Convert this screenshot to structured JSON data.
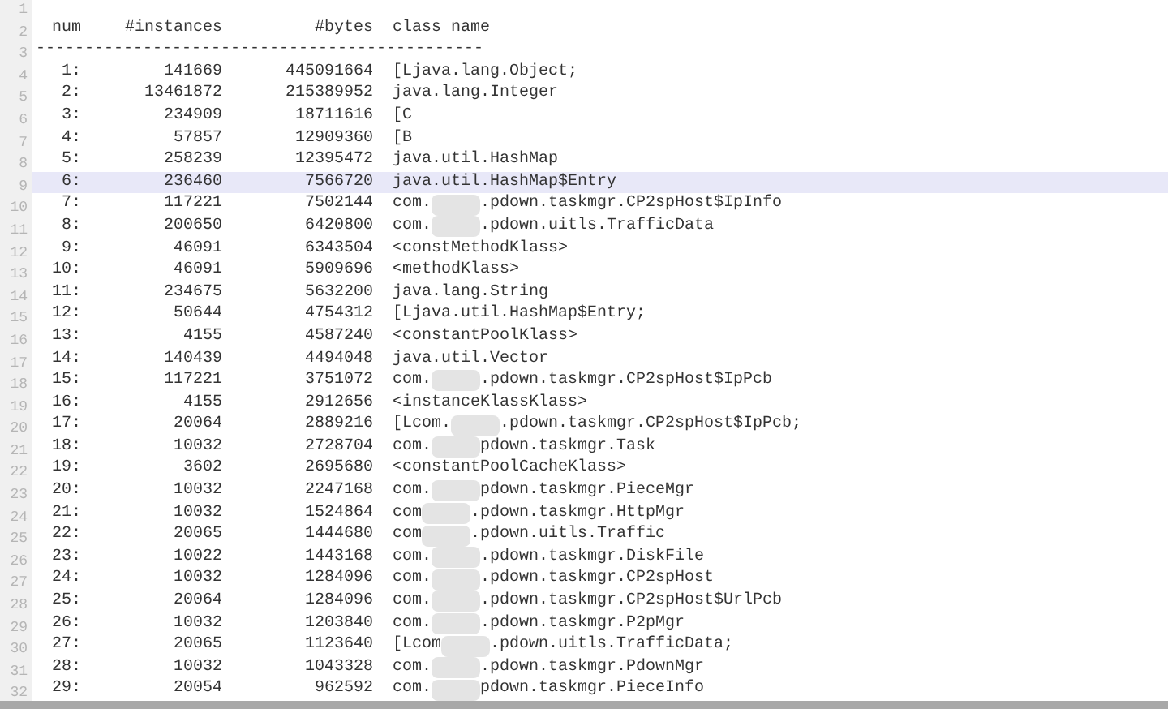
{
  "line_numbers": [
    "1",
    "2",
    "3",
    "4",
    "5",
    "6",
    "7",
    "8",
    "9",
    "10",
    "11",
    "12",
    "13",
    "14",
    "15",
    "16",
    "17",
    "18",
    "19",
    "20",
    "21",
    "22",
    "23",
    "24",
    "25",
    "26",
    "27",
    "28",
    "29",
    "30",
    "31",
    "32"
  ],
  "header": {
    "num": "num",
    "instances": "#instances",
    "bytes": "#bytes",
    "class_name": "class name"
  },
  "separator": "----------------------------------------------",
  "rows": [
    {
      "num": "1:",
      "instances": "141669",
      "bytes": "445091664",
      "class_name": "[Ljava.lang.Object;",
      "selected": false
    },
    {
      "num": "2:",
      "instances": "13461872",
      "bytes": "215389952",
      "class_name": "java.lang.Integer",
      "selected": false
    },
    {
      "num": "3:",
      "instances": "234909",
      "bytes": "18711616",
      "class_name": "[C",
      "selected": false
    },
    {
      "num": "4:",
      "instances": "57857",
      "bytes": "12909360",
      "class_name": "[B",
      "selected": false
    },
    {
      "num": "5:",
      "instances": "258239",
      "bytes": "12395472",
      "class_name": "java.util.HashMap",
      "selected": false
    },
    {
      "num": "6:",
      "instances": "236460",
      "bytes": "7566720",
      "class_name": "java.util.HashMap$Entry",
      "selected": true
    },
    {
      "num": "7:",
      "instances": "117221",
      "bytes": "7502144",
      "class_name": "com.",
      "after_redaction": ".pdown.taskmgr.CP2spHost$IpInfo",
      "selected": false
    },
    {
      "num": "8:",
      "instances": "200650",
      "bytes": "6420800",
      "class_name": "com.",
      "after_redaction": ".pdown.uitls.TrafficData",
      "selected": false
    },
    {
      "num": "9:",
      "instances": "46091",
      "bytes": "6343504",
      "class_name": "<constMethodKlass>",
      "selected": false
    },
    {
      "num": "10:",
      "instances": "46091",
      "bytes": "5909696",
      "class_name": "<methodKlass>",
      "selected": false
    },
    {
      "num": "11:",
      "instances": "234675",
      "bytes": "5632200",
      "class_name": "java.lang.String",
      "selected": false
    },
    {
      "num": "12:",
      "instances": "50644",
      "bytes": "4754312",
      "class_name": "[Ljava.util.HashMap$Entry;",
      "selected": false
    },
    {
      "num": "13:",
      "instances": "4155",
      "bytes": "4587240",
      "class_name": "<constantPoolKlass>",
      "selected": false
    },
    {
      "num": "14:",
      "instances": "140439",
      "bytes": "4494048",
      "class_name": "java.util.Vector",
      "selected": false
    },
    {
      "num": "15:",
      "instances": "117221",
      "bytes": "3751072",
      "class_name": "com.",
      "after_redaction": ".pdown.taskmgr.CP2spHost$IpPcb",
      "selected": false
    },
    {
      "num": "16:",
      "instances": "4155",
      "bytes": "2912656",
      "class_name": "<instanceKlassKlass>",
      "selected": false
    },
    {
      "num": "17:",
      "instances": "20064",
      "bytes": "2889216",
      "class_name": "[Lcom.",
      "after_redaction": ".pdown.taskmgr.CP2spHost$IpPcb;",
      "selected": false
    },
    {
      "num": "18:",
      "instances": "10032",
      "bytes": "2728704",
      "class_name": "com.",
      "after_redaction": "pdown.taskmgr.Task",
      "selected": false
    },
    {
      "num": "19:",
      "instances": "3602",
      "bytes": "2695680",
      "class_name": "<constantPoolCacheKlass>",
      "selected": false
    },
    {
      "num": "20:",
      "instances": "10032",
      "bytes": "2247168",
      "class_name": "com.",
      "after_redaction": "pdown.taskmgr.PieceMgr",
      "selected": false
    },
    {
      "num": "21:",
      "instances": "10032",
      "bytes": "1524864",
      "class_name": "com",
      "after_redaction": ".pdown.taskmgr.HttpMgr",
      "selected": false
    },
    {
      "num": "22:",
      "instances": "20065",
      "bytes": "1444680",
      "class_name": "com",
      "after_redaction": ".pdown.uitls.Traffic",
      "selected": false
    },
    {
      "num": "23:",
      "instances": "10022",
      "bytes": "1443168",
      "class_name": "com.",
      "after_redaction": ".pdown.taskmgr.DiskFile",
      "selected": false
    },
    {
      "num": "24:",
      "instances": "10032",
      "bytes": "1284096",
      "class_name": "com.",
      "after_redaction": ".pdown.taskmgr.CP2spHost",
      "selected": false
    },
    {
      "num": "25:",
      "instances": "20064",
      "bytes": "1284096",
      "class_name": "com.",
      "after_redaction": ".pdown.taskmgr.CP2spHost$UrlPcb",
      "selected": false
    },
    {
      "num": "26:",
      "instances": "10032",
      "bytes": "1203840",
      "class_name": "com.",
      "after_redaction": ".pdown.taskmgr.P2pMgr",
      "selected": false
    },
    {
      "num": "27:",
      "instances": "20065",
      "bytes": "1123640",
      "class_name": "[Lcom",
      "after_redaction": ".pdown.uitls.TrafficData;",
      "selected": false
    },
    {
      "num": "28:",
      "instances": "10032",
      "bytes": "1043328",
      "class_name": "com.",
      "after_redaction": ".pdown.taskmgr.PdownMgr",
      "selected": false
    },
    {
      "num": "29:",
      "instances": "20054",
      "bytes": "962592",
      "class_name": "com.",
      "after_redaction": "pdown.taskmgr.PieceInfo",
      "selected": false
    }
  ]
}
